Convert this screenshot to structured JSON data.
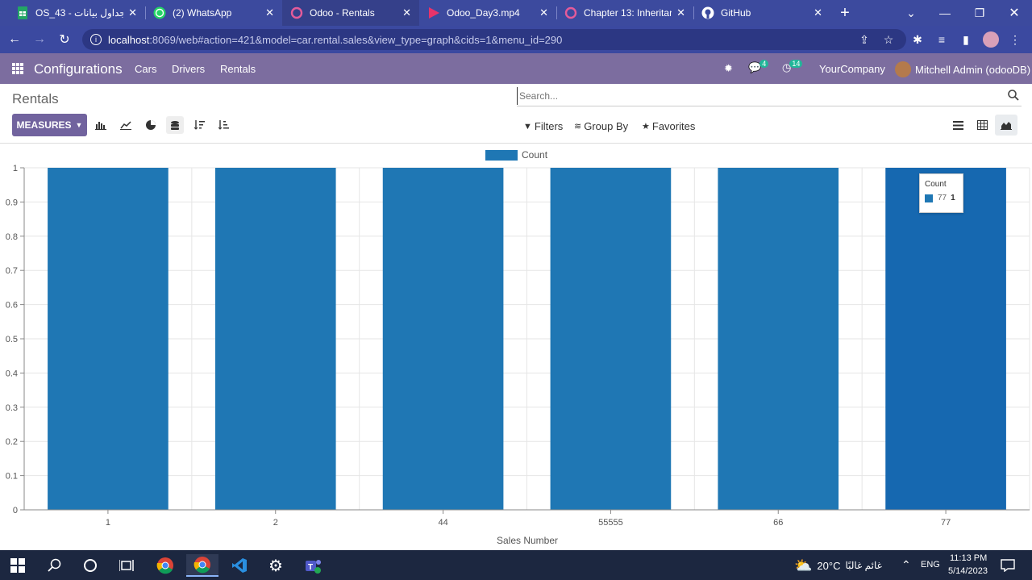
{
  "browser": {
    "tabs": [
      {
        "title": "OS_43 - جداول بيانات G",
        "icon": "sheets-icon",
        "active": false
      },
      {
        "title": "(2) WhatsApp",
        "icon": "whatsapp-icon",
        "active": false
      },
      {
        "title": "Odoo - Rentals",
        "icon": "odoo-icon",
        "active": true
      },
      {
        "title": "Odoo_Day3.mp4",
        "icon": "video-icon",
        "active": false
      },
      {
        "title": "Chapter 13: Inheritanc",
        "icon": "odoo-icon",
        "active": false
      },
      {
        "title": "GitHub",
        "icon": "github-icon",
        "active": false
      }
    ],
    "url_host": "localhost",
    "url_path": ":8069/web#action=421&model=car.rental.sales&view_type=graph&cids=1&menu_id=290"
  },
  "odoo": {
    "app_name": "Configurations",
    "menu": [
      "Cars",
      "Drivers",
      "Rentals"
    ],
    "messages_badge": "4",
    "activities_badge": "14",
    "company": "YourCompany",
    "user": "Mitchell Admin (odooDB)"
  },
  "control_panel": {
    "breadcrumb": "Rentals",
    "search_placeholder": "Search...",
    "measures_label": "MEASURES",
    "filters_label": "Filters",
    "group_by_label": "Group By",
    "favorites_label": "Favorites"
  },
  "tooltip": {
    "title": "Count",
    "label": "77",
    "value": "1"
  },
  "chart_data": {
    "type": "bar",
    "categories": [
      "1",
      "2",
      "44",
      "55555",
      "66",
      "77"
    ],
    "series": [
      {
        "name": "Count",
        "values": [
          1,
          1,
          1,
          1,
          1,
          1
        ]
      }
    ],
    "xlabel": "Sales Number",
    "ylabel": "",
    "ylim": [
      0,
      1
    ],
    "yticks": [
      "0",
      "0.1",
      "0.2",
      "0.3",
      "0.4",
      "0.5",
      "0.6",
      "0.7",
      "0.8",
      "0.9",
      "1"
    ],
    "grid": true,
    "legend": "top-center",
    "color": "#1f77b4",
    "highlight_color": "#1668b0"
  },
  "taskbar": {
    "weather_temp": "20°C",
    "weather_text": "غائم غالبًا",
    "lang": "ENG",
    "time": "11:13 PM",
    "date": "5/14/2023"
  }
}
